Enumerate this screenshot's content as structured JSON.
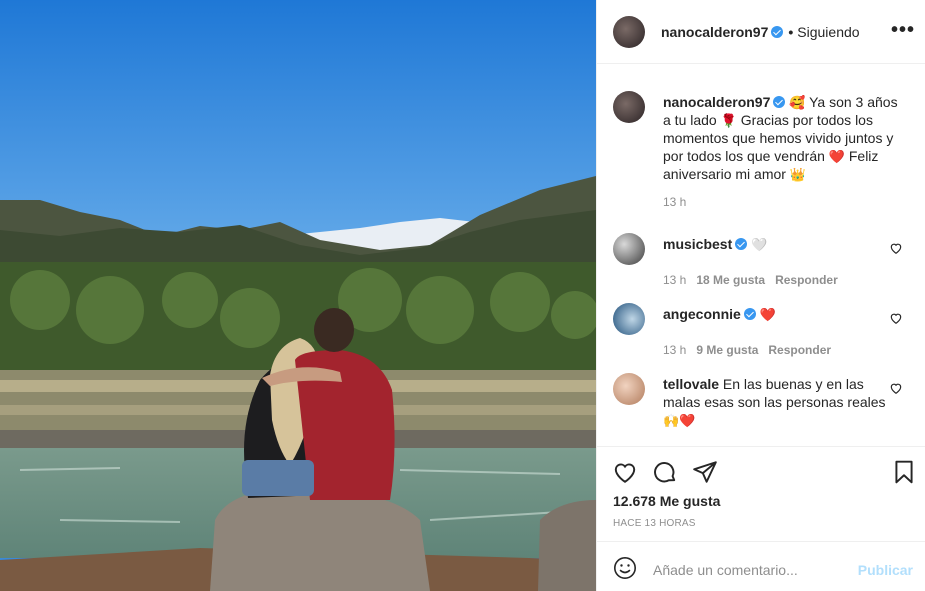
{
  "post": {
    "author": "nanocalderon97",
    "follow_status": "Siguiendo",
    "more_label": "•••"
  },
  "caption": {
    "username": "nanocalderon97",
    "text_1": "Ya son 3 años a tu lado",
    "text_2": "Gracias por todos los momentos que hemos vivido juntos y por todos los que vendrán",
    "text_3": "Feliz aniversario mi amor",
    "emojis": [
      "🥰",
      "🌹",
      "❤️",
      "👑"
    ],
    "time": "13 h"
  },
  "comments": [
    {
      "username": "musicbest",
      "text": "",
      "emoji": "🤍",
      "time": "13 h",
      "likes": "18 Me gusta",
      "reply": "Responder"
    },
    {
      "username": "angeconnie",
      "text": "",
      "emoji": "❤️",
      "time": "13 h",
      "likes": "9 Me gusta",
      "reply": "Responder"
    },
    {
      "username": "tellovale",
      "text": "En las buenas y en las malas esas son las personas reales",
      "emoji": "🙌❤️"
    }
  ],
  "stats": {
    "likes": "12.678 Me gusta",
    "posted_ago": "HACE 13 HORAS"
  },
  "composer": {
    "placeholder": "Añade un comentario...",
    "publish_label": "Publicar"
  },
  "colors": {
    "verified": "#3897f0",
    "heart_red": "#ed4956",
    "publish_disabled": "#b2dffc",
    "muted": "#8e8e8e"
  }
}
